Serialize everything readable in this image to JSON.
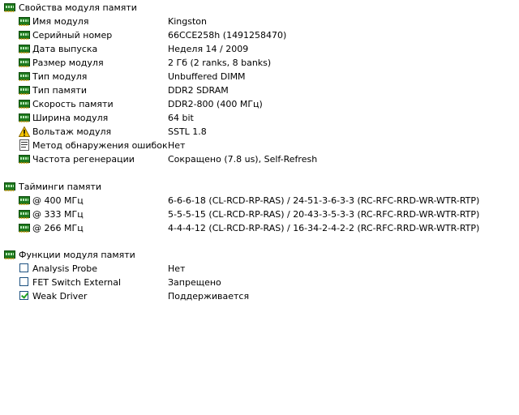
{
  "module_props": {
    "title": "Свойства модуля памяти",
    "rows": [
      {
        "label": "Имя модуля",
        "value": "Kingston"
      },
      {
        "label": "Серийный номер",
        "value": "66CCE258h (1491258470)"
      },
      {
        "label": "Дата выпуска",
        "value": "Неделя 14 / 2009"
      },
      {
        "label": "Размер модуля",
        "value": "2 Гб (2 ranks, 8 banks)"
      },
      {
        "label": "Тип модуля",
        "value": "Unbuffered DIMM"
      },
      {
        "label": "Тип памяти",
        "value": "DDR2 SDRAM"
      },
      {
        "label": "Скорость памяти",
        "value": "DDR2-800 (400 МГц)"
      },
      {
        "label": "Ширина модуля",
        "value": "64 bit"
      },
      {
        "label": "Вольтаж модуля",
        "value": "SSTL 1.8"
      },
      {
        "label": "Метод обнаружения ошибок",
        "value": "Нет"
      },
      {
        "label": "Частота регенерации",
        "value": "Сокращено (7.8 us), Self-Refresh"
      }
    ]
  },
  "timings": {
    "title": "Тайминги памяти",
    "rows": [
      {
        "label": "@ 400 МГц",
        "value": "6-6-6-18  (CL-RCD-RP-RAS) / 24-51-3-6-3-3  (RC-RFC-RRD-WR-WTR-RTP)"
      },
      {
        "label": "@ 333 МГц",
        "value": "5-5-5-15  (CL-RCD-RP-RAS) / 20-43-3-5-3-3  (RC-RFC-RRD-WR-WTR-RTP)"
      },
      {
        "label": "@ 266 МГц",
        "value": "4-4-4-12  (CL-RCD-RP-RAS) / 16-34-2-4-2-2  (RC-RFC-RRD-WR-WTR-RTP)"
      }
    ]
  },
  "functions": {
    "title": "Функции модуля памяти",
    "rows": [
      {
        "label": "Analysis Probe",
        "value": "Нет",
        "checked": false
      },
      {
        "label": "FET Switch External",
        "value": "Запрещено",
        "checked": false
      },
      {
        "label": "Weak Driver",
        "value": "Поддерживается",
        "checked": true
      }
    ]
  },
  "icons": {
    "section": "memory-module-icon",
    "item": "memory-module-icon",
    "voltage": "warning-icon",
    "error_detection": "document-icon"
  },
  "colors": {
    "module_green": "#1e7a1e",
    "warning_yellow": "#f5c400",
    "checkbox_border": "#1c5180",
    "checkmark": "#21a121"
  }
}
